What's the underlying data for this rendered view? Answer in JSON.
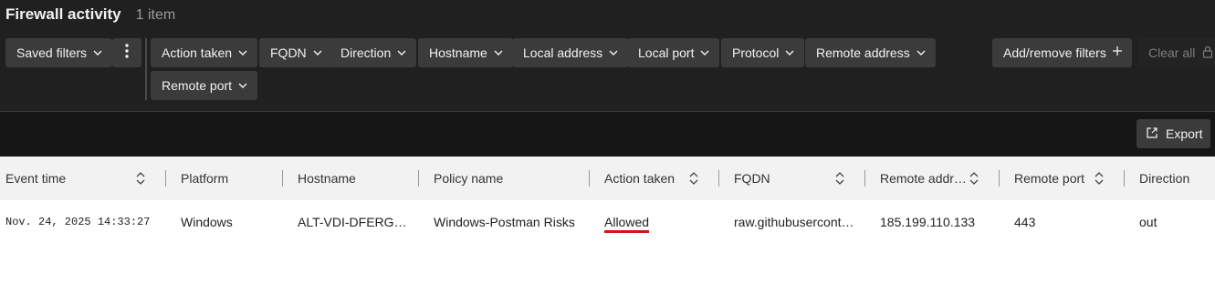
{
  "header": {
    "title": "Firewall activity",
    "count": "1 item"
  },
  "filters": {
    "saved_filters": "Saved filters",
    "chips": [
      "Action taken",
      "FQDN",
      "Direction",
      "Hostname",
      "Local address",
      "Local port",
      "Protocol",
      "Remote address",
      "Remote port"
    ],
    "add_remove": "Add/remove filters",
    "clear_all": "Clear all"
  },
  "toolbar": {
    "export": "Export"
  },
  "table": {
    "columns": [
      "Event time",
      "Platform",
      "Hostname",
      "Policy name",
      "Action taken",
      "FQDN",
      "Remote addr…",
      "Remote port",
      "Direction"
    ],
    "rows": [
      {
        "event_time": "Nov. 24, 2025 14:33:27",
        "platform": "Windows",
        "hostname": "ALT-VDI-DFERG…",
        "policy_name": "Windows-Postman Risks",
        "action_taken": "Allowed",
        "fqdn": "raw.githubusercont…",
        "remote_address": "185.199.110.133",
        "remote_port": "443",
        "direction": "out"
      }
    ]
  },
  "colors": {
    "background_dark": "#202020",
    "chip": "#3b3b3b",
    "highlight_underline": "#d61414"
  },
  "icons": [
    "chevron-down-icon",
    "kebab-menu-icon",
    "plus-icon",
    "lock-icon",
    "export-icon",
    "sort-icon"
  ]
}
